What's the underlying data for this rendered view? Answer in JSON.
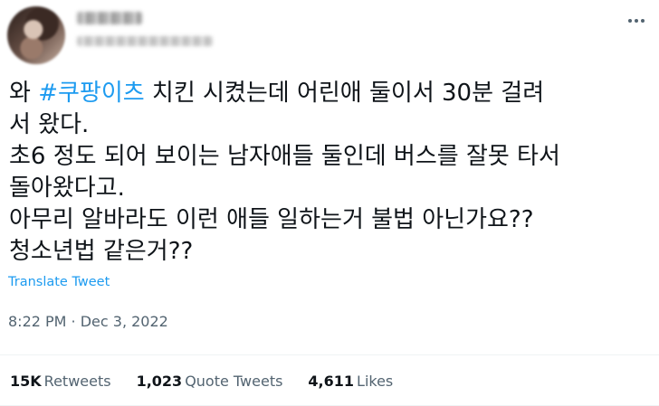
{
  "tweet": {
    "text_prefix": "와 ",
    "hashtag": "#쿠팡이츠",
    "text_body": " 치킨 시켰는데 어린애 둘이서 30분 걸려\n서 왔다.\n초6 정도 되어 보이는 남자애들 둘인데 버스를 잘못 타서\n돌아왔다고.\n아무리 알바라도 이런 애들 일하는거 불법 아닌가요??\n청소년법 같은거??",
    "translate_label": "Translate Tweet",
    "timestamp": "8:22 PM · Dec 3, 2022"
  },
  "stats": {
    "retweets_count": "15K",
    "retweets_label": "Retweets",
    "quotes_count": "1,023",
    "quotes_label": "Quote Tweets",
    "likes_count": "4,611",
    "likes_label": "Likes"
  },
  "colors": {
    "link": "#1d9bf0",
    "text": "#0f1419",
    "muted": "#536471",
    "divider": "#eff3f4"
  },
  "icons": {
    "more": "more-options-icon"
  }
}
